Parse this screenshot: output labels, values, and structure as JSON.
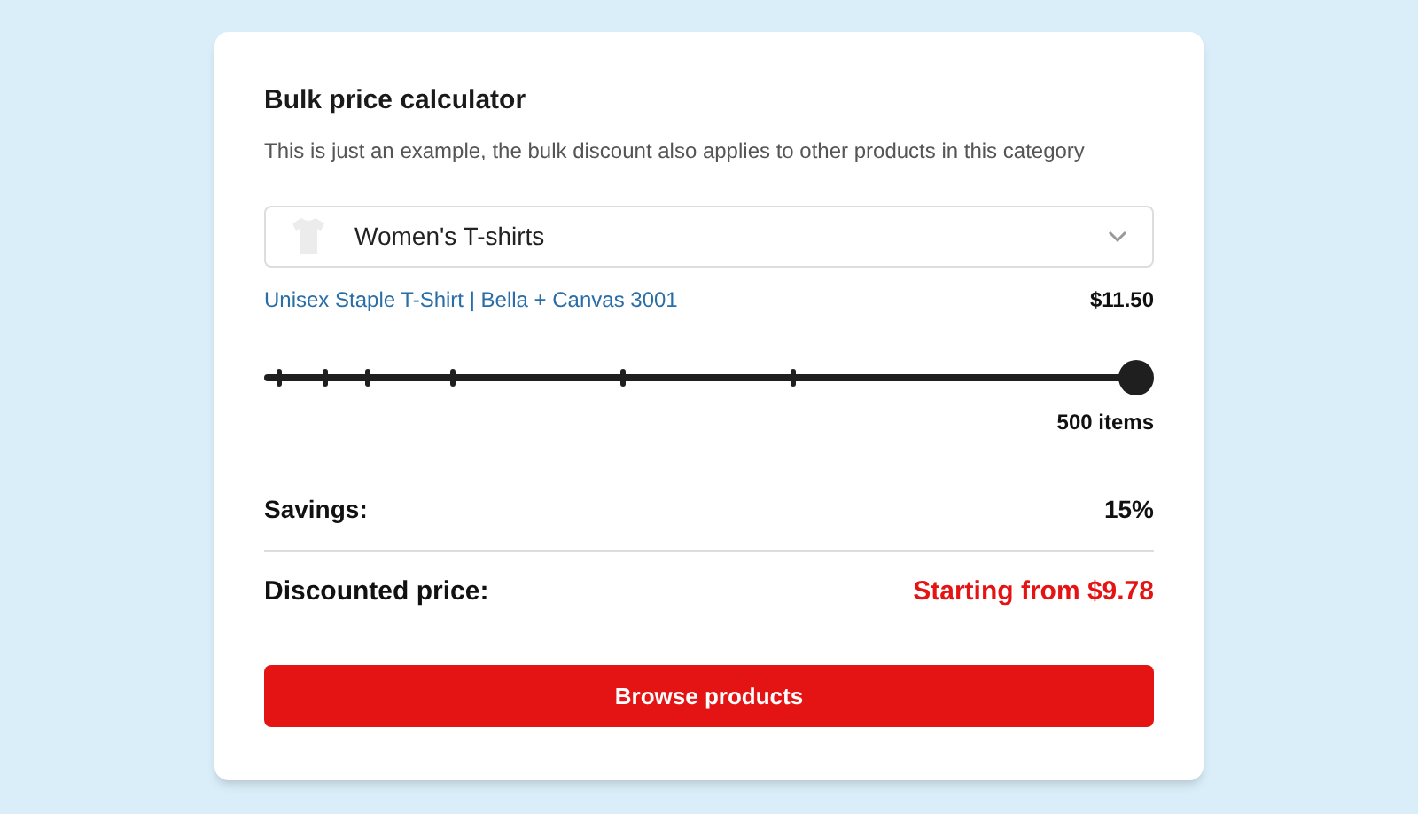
{
  "title": "Bulk price calculator",
  "description": "This is just an example, the bulk discount also applies to other products in this category",
  "category_select": {
    "value": "Women's T-shirts"
  },
  "product": {
    "name": "Unisex Staple T-Shirt | Bella + Canvas 3001",
    "price": "$11.50"
  },
  "quantity_slider": {
    "level": 1,
    "reading": "500 items"
  },
  "savings": {
    "label": "Savings:",
    "value": "15%"
  },
  "discounted_price": {
    "label": "Discounted price:",
    "value": "Starting from $9.78"
  },
  "button": "Browse products"
}
